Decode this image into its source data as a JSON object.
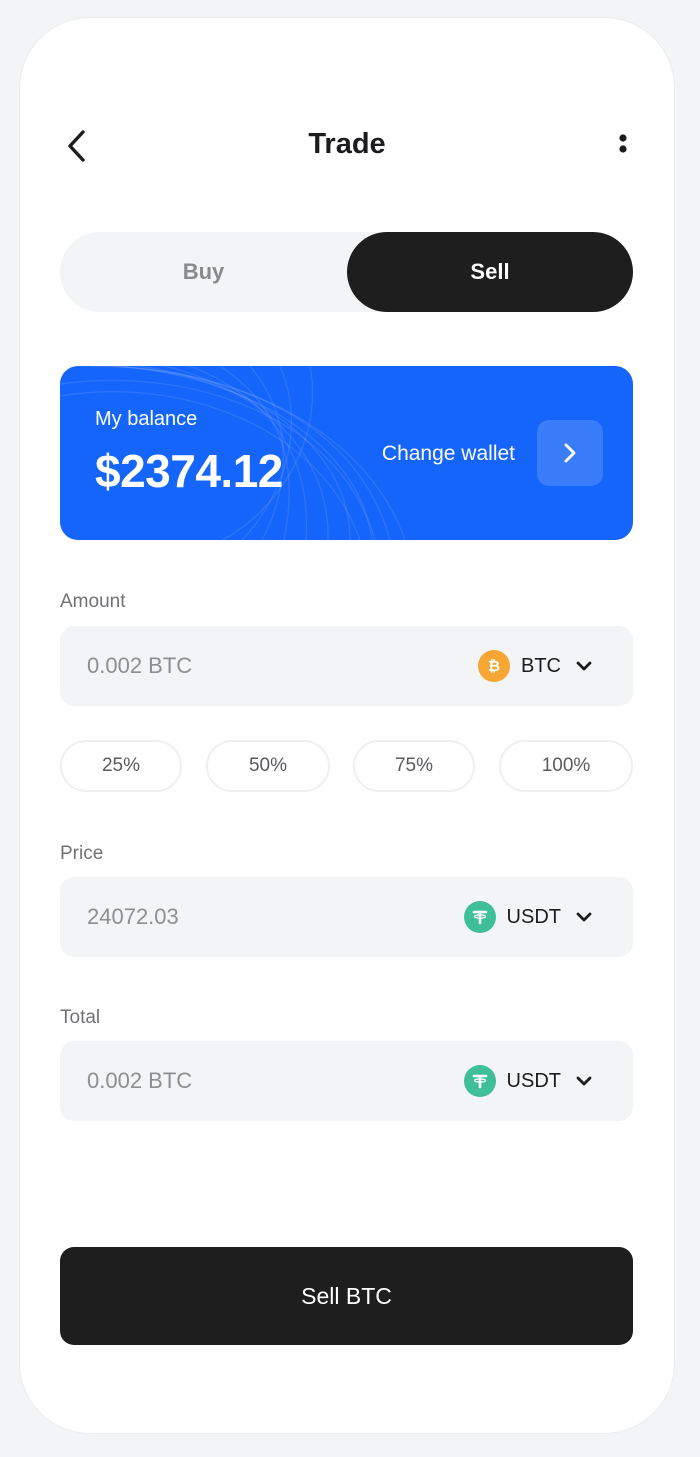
{
  "header": {
    "title": "Trade",
    "back_icon": "chevron-left-icon",
    "more_icon": "more-vertical-icon"
  },
  "toggle": {
    "buy_label": "Buy",
    "sell_label": "Sell",
    "selected": "Sell"
  },
  "balance": {
    "label": "My balance",
    "amount": "$2374.12",
    "change_wallet_label": "Change wallet",
    "arrow_icon": "chevron-right-icon",
    "card_color": "#1565fa"
  },
  "amount": {
    "label": "Amount",
    "value": "0.002 BTC",
    "currency": "BTC",
    "coin_icon": "bitcoin-icon"
  },
  "percent_options": [
    "25%",
    "50%",
    "75%",
    "100%"
  ],
  "price": {
    "label": "Price",
    "value": "24072.03",
    "currency": "USDT",
    "coin_icon": "tether-icon"
  },
  "total": {
    "label": "Total",
    "value": "0.002 BTC",
    "currency": "USDT",
    "coin_icon": "tether-icon"
  },
  "action": {
    "label": "Sell BTC"
  },
  "colors": {
    "accent": "#1565fa",
    "dark": "#1e1e1f",
    "btc": "#f7a634",
    "usdt": "#3fbf95"
  }
}
